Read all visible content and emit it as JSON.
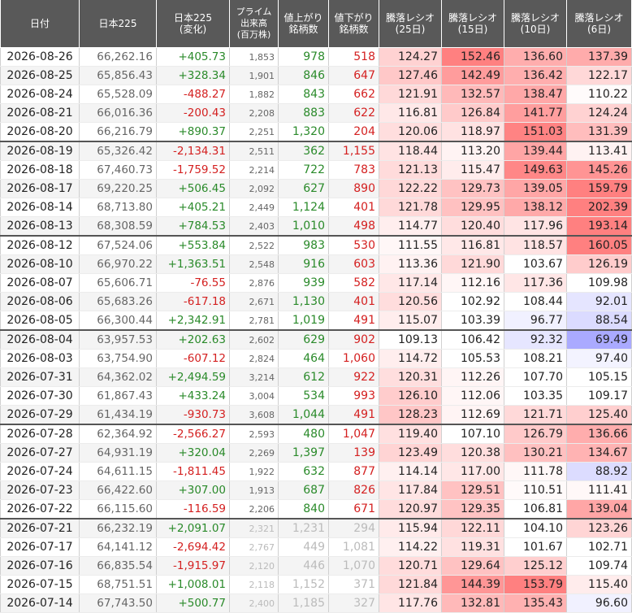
{
  "headers": {
    "date": "日付",
    "nikkei": "日本225",
    "change_l1": "日本225",
    "change_l2": "(変化)",
    "volume_l1": "プライム",
    "volume_l2": "出来高",
    "volume_l3": "(百万株)",
    "adv_l1": "値上がり",
    "adv_l2": "銘柄数",
    "dec_l1": "値下がり",
    "dec_l2": "銘柄数",
    "r25_l1": "騰落レシオ",
    "r25_l2": "(25日)",
    "r15_l1": "騰落レシオ",
    "r15_l2": "(15日)",
    "r10_l1": "騰落レシオ",
    "r10_l2": "(10日)",
    "r6_l1": "騰落レシオ",
    "r6_l2": "(6日)"
  },
  "colors": {
    "header_bg": "#595959",
    "positive": "#2a8a2a",
    "negative": "#d42020",
    "heat_high": "#f07878",
    "heat_low": "#a8a8f8"
  },
  "rows": [
    {
      "date": "2026-08-26",
      "nikkei": "66,262.16",
      "change": "+405.73",
      "volume": "1,853",
      "adv": "978",
      "dec": "518",
      "r25": "124.27",
      "r15": "152.46",
      "r10": "136.60",
      "r6": "137.39",
      "dim": false,
      "sep": false
    },
    {
      "date": "2026-08-25",
      "nikkei": "65,856.43",
      "change": "+328.34",
      "volume": "1,901",
      "adv": "846",
      "dec": "647",
      "r25": "127.46",
      "r15": "142.49",
      "r10": "136.42",
      "r6": "122.17",
      "dim": false,
      "sep": false
    },
    {
      "date": "2026-08-24",
      "nikkei": "65,528.09",
      "change": "-488.27",
      "volume": "1,882",
      "adv": "843",
      "dec": "662",
      "r25": "121.91",
      "r15": "132.57",
      "r10": "138.47",
      "r6": "110.22",
      "dim": false,
      "sep": false
    },
    {
      "date": "2026-08-21",
      "nikkei": "66,016.36",
      "change": "-200.43",
      "volume": "2,208",
      "adv": "883",
      "dec": "622",
      "r25": "116.81",
      "r15": "126.84",
      "r10": "141.77",
      "r6": "124.24",
      "dim": false,
      "sep": false
    },
    {
      "date": "2026-08-20",
      "nikkei": "66,216.79",
      "change": "+890.37",
      "volume": "2,251",
      "adv": "1,320",
      "dec": "204",
      "r25": "120.06",
      "r15": "118.97",
      "r10": "151.03",
      "r6": "131.39",
      "dim": false,
      "sep": true
    },
    {
      "date": "2026-08-19",
      "nikkei": "65,326.42",
      "change": "-2,134.31",
      "volume": "2,511",
      "adv": "362",
      "dec": "1,155",
      "r25": "118.44",
      "r15": "113.20",
      "r10": "139.44",
      "r6": "113.41",
      "dim": false,
      "sep": false
    },
    {
      "date": "2026-08-18",
      "nikkei": "67,460.73",
      "change": "-1,759.52",
      "volume": "2,214",
      "adv": "722",
      "dec": "783",
      "r25": "121.13",
      "r15": "115.47",
      "r10": "149.63",
      "r6": "145.26",
      "dim": false,
      "sep": false
    },
    {
      "date": "2026-08-17",
      "nikkei": "69,220.25",
      "change": "+506.45",
      "volume": "2,092",
      "adv": "627",
      "dec": "890",
      "r25": "122.22",
      "r15": "129.73",
      "r10": "139.05",
      "r6": "159.79",
      "dim": false,
      "sep": false
    },
    {
      "date": "2026-08-14",
      "nikkei": "68,713.80",
      "change": "+405.21",
      "volume": "2,449",
      "adv": "1,124",
      "dec": "401",
      "r25": "121.78",
      "r15": "129.95",
      "r10": "138.12",
      "r6": "202.39",
      "dim": false,
      "sep": false
    },
    {
      "date": "2026-08-13",
      "nikkei": "68,308.59",
      "change": "+784.53",
      "volume": "2,403",
      "adv": "1,010",
      "dec": "498",
      "r25": "114.77",
      "r15": "120.40",
      "r10": "117.96",
      "r6": "193.14",
      "dim": false,
      "sep": true
    },
    {
      "date": "2026-08-12",
      "nikkei": "67,524.06",
      "change": "+553.84",
      "volume": "2,522",
      "adv": "983",
      "dec": "530",
      "r25": "111.55",
      "r15": "116.81",
      "r10": "118.57",
      "r6": "160.05",
      "dim": false,
      "sep": false
    },
    {
      "date": "2026-08-10",
      "nikkei": "66,970.22",
      "change": "+1,363.51",
      "volume": "2,548",
      "adv": "916",
      "dec": "603",
      "r25": "113.36",
      "r15": "121.90",
      "r10": "103.67",
      "r6": "126.19",
      "dim": false,
      "sep": false
    },
    {
      "date": "2026-08-07",
      "nikkei": "65,606.71",
      "change": "-76.55",
      "volume": "2,876",
      "adv": "939",
      "dec": "582",
      "r25": "117.14",
      "r15": "112.16",
      "r10": "117.36",
      "r6": "109.98",
      "dim": false,
      "sep": false
    },
    {
      "date": "2026-08-06",
      "nikkei": "65,683.26",
      "change": "-617.18",
      "volume": "2,671",
      "adv": "1,130",
      "dec": "401",
      "r25": "120.56",
      "r15": "102.92",
      "r10": "108.44",
      "r6": "92.01",
      "dim": false,
      "sep": false
    },
    {
      "date": "2026-08-05",
      "nikkei": "66,300.44",
      "change": "+2,342.91",
      "volume": "2,781",
      "adv": "1,019",
      "dec": "491",
      "r25": "115.07",
      "r15": "103.39",
      "r10": "96.77",
      "r6": "88.54",
      "dim": false,
      "sep": true
    },
    {
      "date": "2026-08-04",
      "nikkei": "63,957.53",
      "change": "+202.63",
      "volume": "2,602",
      "adv": "629",
      "dec": "902",
      "r25": "109.13",
      "r15": "106.42",
      "r10": "92.32",
      "r6": "69.49",
      "dim": false,
      "sep": false
    },
    {
      "date": "2026-08-03",
      "nikkei": "63,754.90",
      "change": "-607.12",
      "volume": "2,824",
      "adv": "464",
      "dec": "1,060",
      "r25": "114.72",
      "r15": "105.53",
      "r10": "108.21",
      "r6": "97.40",
      "dim": false,
      "sep": false
    },
    {
      "date": "2026-07-31",
      "nikkei": "64,362.02",
      "change": "+2,494.59",
      "volume": "3,214",
      "adv": "612",
      "dec": "922",
      "r25": "120.31",
      "r15": "112.26",
      "r10": "107.70",
      "r6": "105.15",
      "dim": false,
      "sep": false
    },
    {
      "date": "2026-07-30",
      "nikkei": "61,867.43",
      "change": "+433.24",
      "volume": "3,004",
      "adv": "534",
      "dec": "993",
      "r25": "126.10",
      "r15": "112.06",
      "r10": "103.35",
      "r6": "109.17",
      "dim": false,
      "sep": false
    },
    {
      "date": "2026-07-29",
      "nikkei": "61,434.19",
      "change": "-930.73",
      "volume": "3,608",
      "adv": "1,044",
      "dec": "491",
      "r25": "128.23",
      "r15": "112.69",
      "r10": "121.71",
      "r6": "125.40",
      "dim": false,
      "sep": true
    },
    {
      "date": "2026-07-28",
      "nikkei": "62,364.92",
      "change": "-2,566.27",
      "volume": "2,593",
      "adv": "480",
      "dec": "1,047",
      "r25": "119.40",
      "r15": "107.10",
      "r10": "126.79",
      "r6": "136.66",
      "dim": false,
      "sep": false
    },
    {
      "date": "2026-07-27",
      "nikkei": "64,931.19",
      "change": "+320.04",
      "volume": "2,269",
      "adv": "1,397",
      "dec": "139",
      "r25": "123.49",
      "r15": "120.38",
      "r10": "130.21",
      "r6": "134.67",
      "dim": false,
      "sep": false
    },
    {
      "date": "2026-07-24",
      "nikkei": "64,611.15",
      "change": "-1,811.45",
      "volume": "1,922",
      "adv": "632",
      "dec": "877",
      "r25": "114.14",
      "r15": "117.00",
      "r10": "111.78",
      "r6": "88.92",
      "dim": false,
      "sep": false
    },
    {
      "date": "2026-07-23",
      "nikkei": "66,422.60",
      "change": "+307.00",
      "volume": "1,913",
      "adv": "687",
      "dec": "826",
      "r25": "117.84",
      "r15": "129.51",
      "r10": "110.51",
      "r6": "111.41",
      "dim": false,
      "sep": false
    },
    {
      "date": "2026-07-22",
      "nikkei": "66,115.60",
      "change": "-116.59",
      "volume": "2,206",
      "adv": "840",
      "dec": "671",
      "r25": "120.97",
      "r15": "129.35",
      "r10": "106.81",
      "r6": "139.04",
      "dim": false,
      "sep": true
    },
    {
      "date": "2026-07-21",
      "nikkei": "66,232.19",
      "change": "+2,091.07",
      "volume": "2,321",
      "adv": "1,231",
      "dec": "294",
      "r25": "115.94",
      "r15": "122.11",
      "r10": "104.10",
      "r6": "123.26",
      "dim": true,
      "sep": false
    },
    {
      "date": "2026-07-17",
      "nikkei": "64,141.12",
      "change": "-2,694.42",
      "volume": "2,767",
      "adv": "449",
      "dec": "1,081",
      "r25": "114.22",
      "r15": "119.31",
      "r10": "101.67",
      "r6": "102.71",
      "dim": true,
      "sep": false
    },
    {
      "date": "2026-07-16",
      "nikkei": "66,835.54",
      "change": "-1,915.97",
      "volume": "2,120",
      "adv": "446",
      "dec": "1,070",
      "r25": "120.71",
      "r15": "129.64",
      "r10": "125.12",
      "r6": "109.74",
      "dim": true,
      "sep": false
    },
    {
      "date": "2026-07-15",
      "nikkei": "68,751.51",
      "change": "+1,008.01",
      "volume": "2,118",
      "adv": "1,152",
      "dec": "371",
      "r25": "121.84",
      "r15": "144.39",
      "r10": "153.79",
      "r6": "115.40",
      "dim": true,
      "sep": false
    },
    {
      "date": "2026-07-14",
      "nikkei": "67,743.50",
      "change": "+500.77",
      "volume": "2,400",
      "adv": "1,185",
      "dec": "327",
      "r25": "117.76",
      "r15": "132.81",
      "r10": "135.43",
      "r6": "96.60",
      "dim": true,
      "sep": false
    }
  ]
}
